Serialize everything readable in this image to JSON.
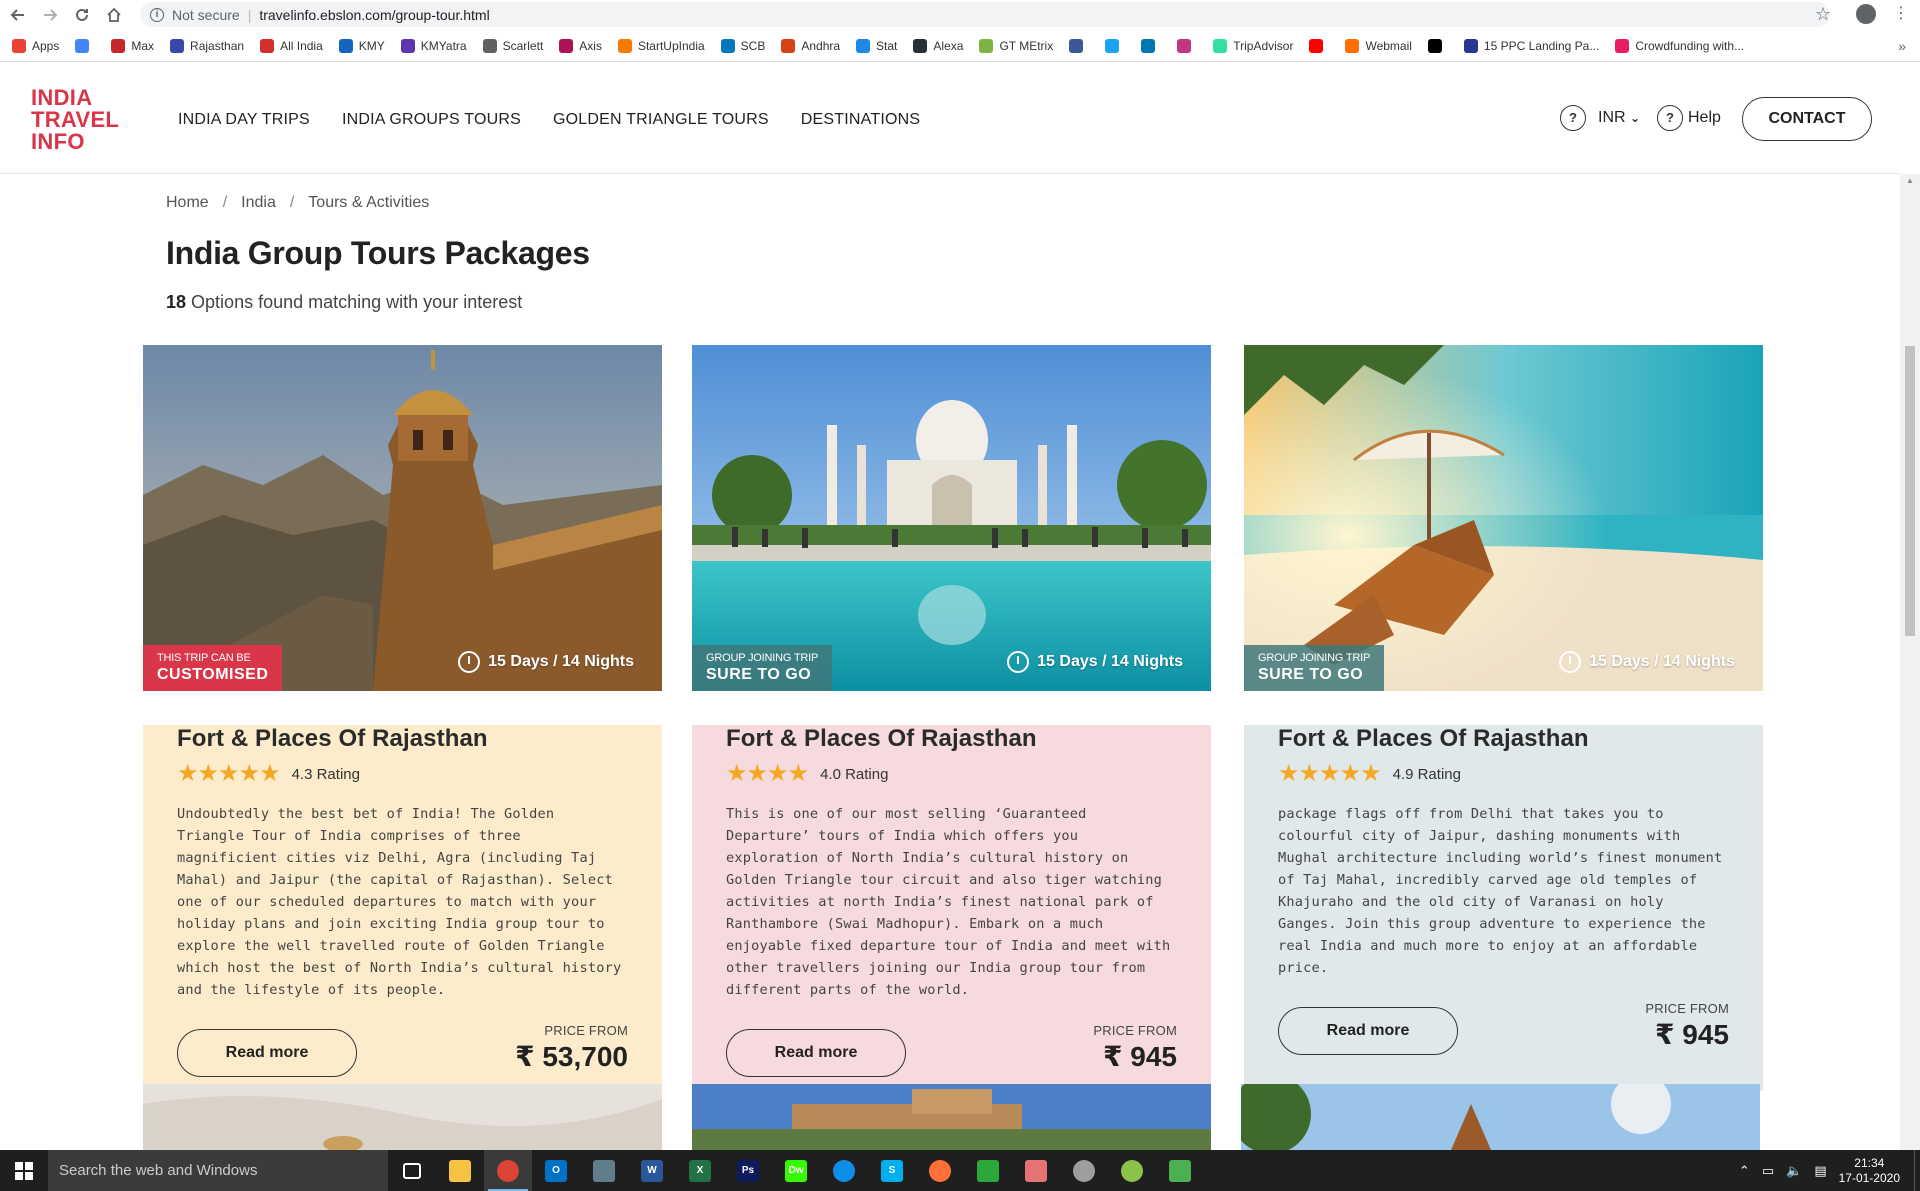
{
  "browser": {
    "security_label": "Not secure",
    "url": "travelinfo.ebslon.com/group-tour.html",
    "bookmarks": [
      {
        "label": "Apps",
        "color": "#ea4335"
      },
      {
        "label": "",
        "color": "#4285f4"
      },
      {
        "label": "Max",
        "color": "#c62828"
      },
      {
        "label": "Rajasthan",
        "color": "#3949ab"
      },
      {
        "label": "All India",
        "color": "#d32f2f"
      },
      {
        "label": "KMY",
        "color": "#1565c0"
      },
      {
        "label": "KMYatra",
        "color": "#5e35b1"
      },
      {
        "label": "Scarlett",
        "color": "#616161"
      },
      {
        "label": "Axis",
        "color": "#ad1457"
      },
      {
        "label": "StartUpIndia",
        "color": "#f57c00"
      },
      {
        "label": "SCB",
        "color": "#0277bd"
      },
      {
        "label": "Andhra",
        "color": "#d84315"
      },
      {
        "label": "Stat",
        "color": "#1e88e5"
      },
      {
        "label": "Alexa",
        "color": "#263238"
      },
      {
        "label": "GT MEtrix",
        "color": "#7cb342"
      },
      {
        "label": "",
        "color": "#3b5998"
      },
      {
        "label": "",
        "color": "#1da1f2"
      },
      {
        "label": "",
        "color": "#0077b5"
      },
      {
        "label": "",
        "color": "#c13584"
      },
      {
        "label": "TripAdvisor",
        "color": "#34e0a1"
      },
      {
        "label": "",
        "color": "#ff0000"
      },
      {
        "label": "Webmail",
        "color": "#ff6d00"
      },
      {
        "label": "",
        "color": "#000000"
      },
      {
        "label": "15 PPC Landing Pa...",
        "color": "#283593"
      },
      {
        "label": "Crowdfunding with...",
        "color": "#e91e63"
      }
    ]
  },
  "site": {
    "logo_lines": [
      "INDIA",
      "TRAVEL",
      "INFO"
    ],
    "nav": [
      "INDIA DAY TRIPS",
      "INDIA GROUPS TOURS",
      "GOLDEN TRIANGLE TOURS",
      "DESTINATIONS"
    ],
    "help_symbol": "?",
    "currency": "INR",
    "help_label": "Help",
    "contact_label": "CONTACT"
  },
  "page": {
    "breadcrumb": [
      "Home",
      "India",
      "Tours & Activities"
    ],
    "breadcrumb_sep": "/",
    "title": "India Group Tours Packages",
    "results_count": "18",
    "results_text": "Options found matching with your interest"
  },
  "cards": [
    {
      "badge_small": "THIS TRIP CAN BE",
      "badge_big": "CUSTOMISED",
      "duration": "15 Days / 14 Nights",
      "title": "Fort & Places Of Rajasthan",
      "stars": "★★★★★",
      "rating_value": 4.3,
      "rating_text": "4.3 Rating",
      "description": "Undoubtedly the best bet of India! The Golden Triangle Tour of India comprises of three magnificient cities viz Delhi, Agra (including Taj Mahal) and Jaipur (the capital of Rajasthan). Select one of our scheduled departures to match with your holiday plans and join exciting India group tour to explore the well travelled route of Golden Triangle which host the best of North India’s cultural history and the lifestyle of its people.",
      "read_more": "Read more",
      "price_label": "PRICE FROM",
      "price": "₹ 53,700",
      "bg": "#fdeccc"
    },
    {
      "badge_small": "GROUP JOINING TRIP",
      "badge_big": "SURE TO GO",
      "duration": "15 Days / 14 Nights",
      "title": "Fort & Places Of Rajasthan",
      "stars": "★★★★",
      "rating_value": 4.0,
      "rating_text": "4.0 Rating",
      "description": "This is one of our most selling ‘Guaranteed Departure’ tours of India which offers you exploration of North India’s cultural history on Golden Triangle tour circuit and also tiger watching activities at north India’s finest national park of Ranthambore (Swai Madhopur). Embark on a much enjoyable fixed departure tour of India and meet with other travellers joining our India group tour from different parts of the world.",
      "read_more": "Read more",
      "price_label": "PRICE FROM",
      "price": "₹ 945",
      "bg": "#f7dadd"
    },
    {
      "badge_small": "GROUP JOINING TRIP",
      "badge_big": "SURE TO GO",
      "duration": "15 Days / 14 Nights",
      "title": "Fort & Places Of Rajasthan",
      "stars": "★★★★★",
      "rating_value": 4.9,
      "rating_text": "4.9 Rating",
      "description": "package flags off from Delhi that takes you to colourful city of Jaipur, dashing monuments with Mughal architecture including world’s finest monument of Taj Mahal, incredibly carved age old temples of Khajuraho and the old city of Varanasi on holy Ganges. Join this group adventure to experience the real India and much more to enjoy at an affordable price.",
      "read_more": "Read more",
      "price_label": "PRICE FROM",
      "price": "₹ 945",
      "bg": "#e1e8ea"
    }
  ],
  "taskbar": {
    "search_placeholder": "Search the web and Windows",
    "apps": [
      {
        "name": "task-view",
        "label": "",
        "color": "#1f1f1f"
      },
      {
        "name": "file-explorer",
        "label": "",
        "color": "#f5c242"
      },
      {
        "name": "chrome",
        "label": "",
        "color": "#db4437"
      },
      {
        "name": "outlook",
        "label": "O",
        "color": "#0072c6"
      },
      {
        "name": "printer",
        "label": "",
        "color": "#607d8b"
      },
      {
        "name": "word",
        "label": "W",
        "color": "#2b579a"
      },
      {
        "name": "excel",
        "label": "X",
        "color": "#217346"
      },
      {
        "name": "photoshop",
        "label": "Ps",
        "color": "#0d1a5c"
      },
      {
        "name": "dreamweaver",
        "label": "Dw",
        "color": "#35fa00"
      },
      {
        "name": "teamviewer",
        "label": "",
        "color": "#0e8ee9"
      },
      {
        "name": "skype",
        "label": "S",
        "color": "#00aff0"
      },
      {
        "name": "firefox",
        "label": "",
        "color": "#ff7139"
      },
      {
        "name": "icq",
        "label": "",
        "color": "#2aa83a"
      },
      {
        "name": "paint",
        "label": "",
        "color": "#e57373"
      },
      {
        "name": "globe",
        "label": "",
        "color": "#9e9e9e"
      },
      {
        "name": "leaf-app",
        "label": "",
        "color": "#8bc34a"
      },
      {
        "name": "icq2",
        "label": "",
        "color": "#4caf50"
      }
    ],
    "time": "21:34",
    "date": "17-01-2020"
  }
}
